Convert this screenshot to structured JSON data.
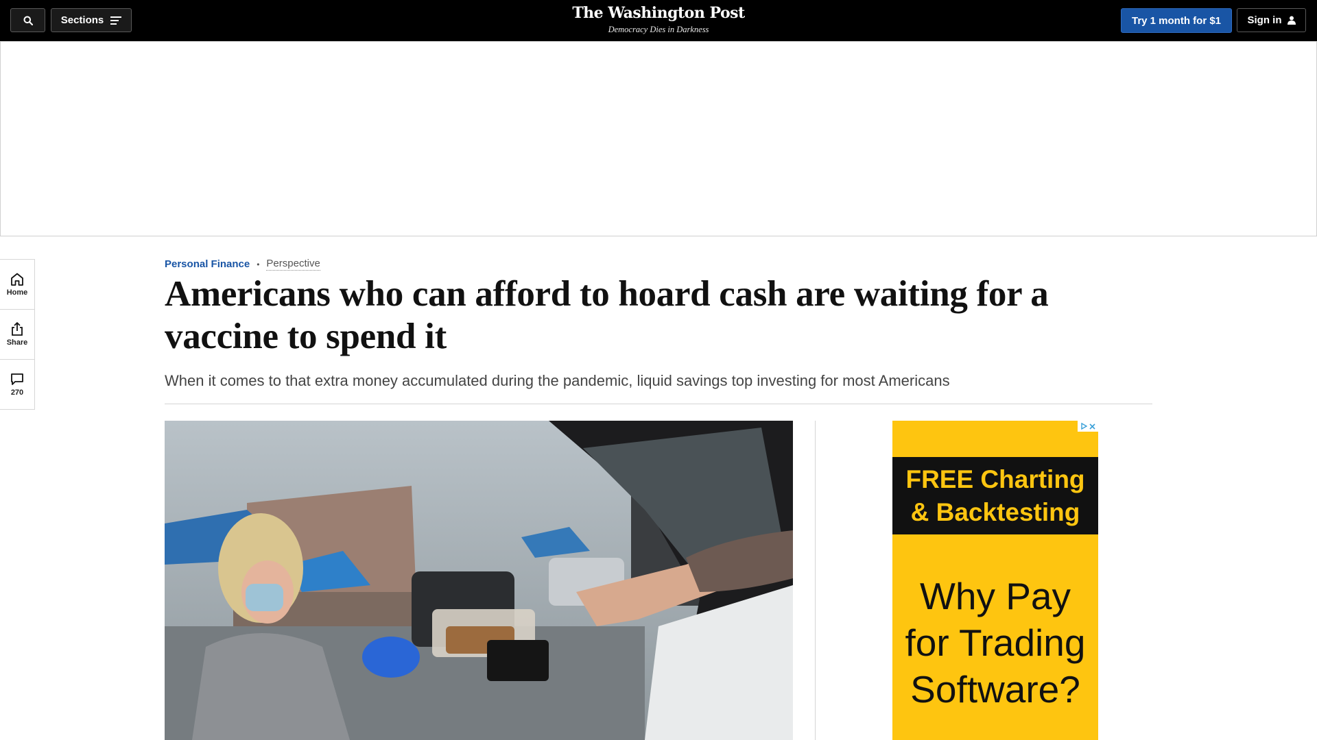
{
  "header": {
    "sections_label": "Sections",
    "logo_title": "The Washington Post",
    "logo_tagline": "Democracy Dies in Darkness",
    "subscribe_label": "Try 1 month for $1",
    "signin_label": "Sign in"
  },
  "rail": {
    "home_label": "Home",
    "share_label": "Share",
    "comments_count": "270"
  },
  "article": {
    "section": "Personal Finance",
    "label": "Perspective",
    "headline": "Americans who can afford to hoard cash are waiting for a vaccine to spend it",
    "subhead": "When it comes to that extra money accumulated during the pandemic, liquid savings top investing for most Americans"
  },
  "side_ad": {
    "headline_line1": "FREE Charting",
    "headline_line2": "& Backtesting",
    "body_line1": "Why Pay",
    "body_line2": "for Trading",
    "body_line3": "Software?"
  },
  "colors": {
    "brand_blue": "#1955a5",
    "ad_yellow": "#fec510",
    "header_bg": "#000000"
  }
}
